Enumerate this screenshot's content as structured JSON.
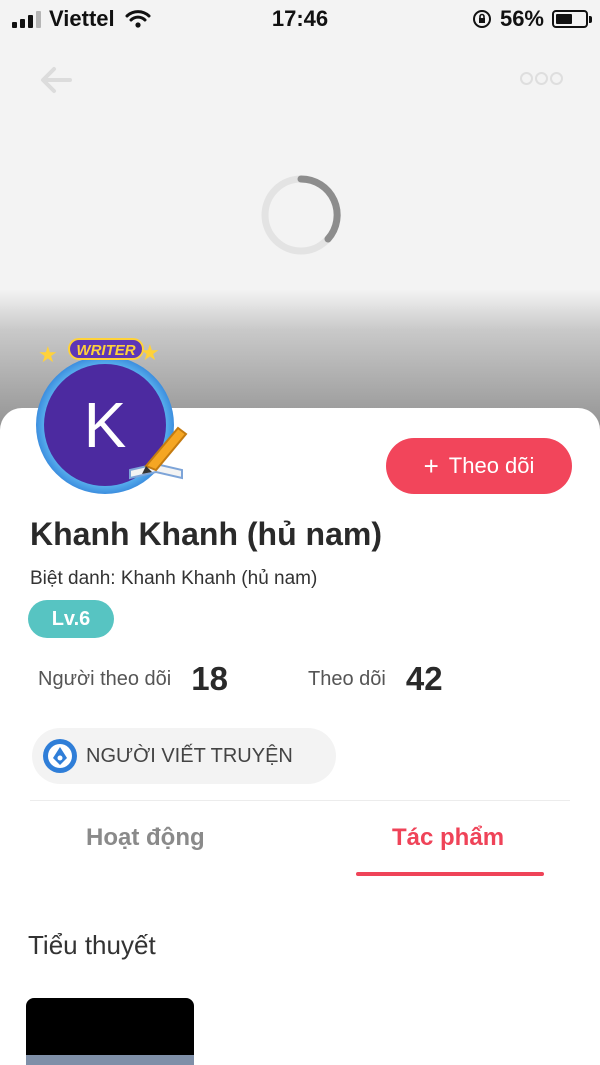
{
  "status_bar": {
    "carrier": "Viettel",
    "time": "17:46",
    "battery": "56%",
    "battery_level": 0.56
  },
  "profile": {
    "badge": "WRITER",
    "avatar_letter": "K",
    "name": "Khanh Khanh (hủ nam)",
    "nickname_label": "Biệt danh:",
    "nickname_value": "Khanh Khanh (hủ nam)",
    "level": "Lv.6",
    "role": "NGƯỜI VIẾT TRUYỆN"
  },
  "follow_button": {
    "label": "Theo dõi"
  },
  "stats": {
    "followers_label": "Người theo dõi",
    "followers_value": "18",
    "following_label": "Theo dõi",
    "following_value": "42"
  },
  "tabs": [
    {
      "label": "Hoạt động",
      "active": false
    },
    {
      "label": "Tác phẩm",
      "active": true
    }
  ],
  "section": {
    "title": "Tiểu thuyết"
  },
  "colors": {
    "accent": "#f2455b",
    "level_badge": "#57c4c2",
    "avatar_bg": "#4c2aa0"
  },
  "icons": {
    "back": "back-arrow-icon",
    "more": "more-dots-icon",
    "spinner": "loading-spinner-icon",
    "role": "writer-role-icon"
  }
}
